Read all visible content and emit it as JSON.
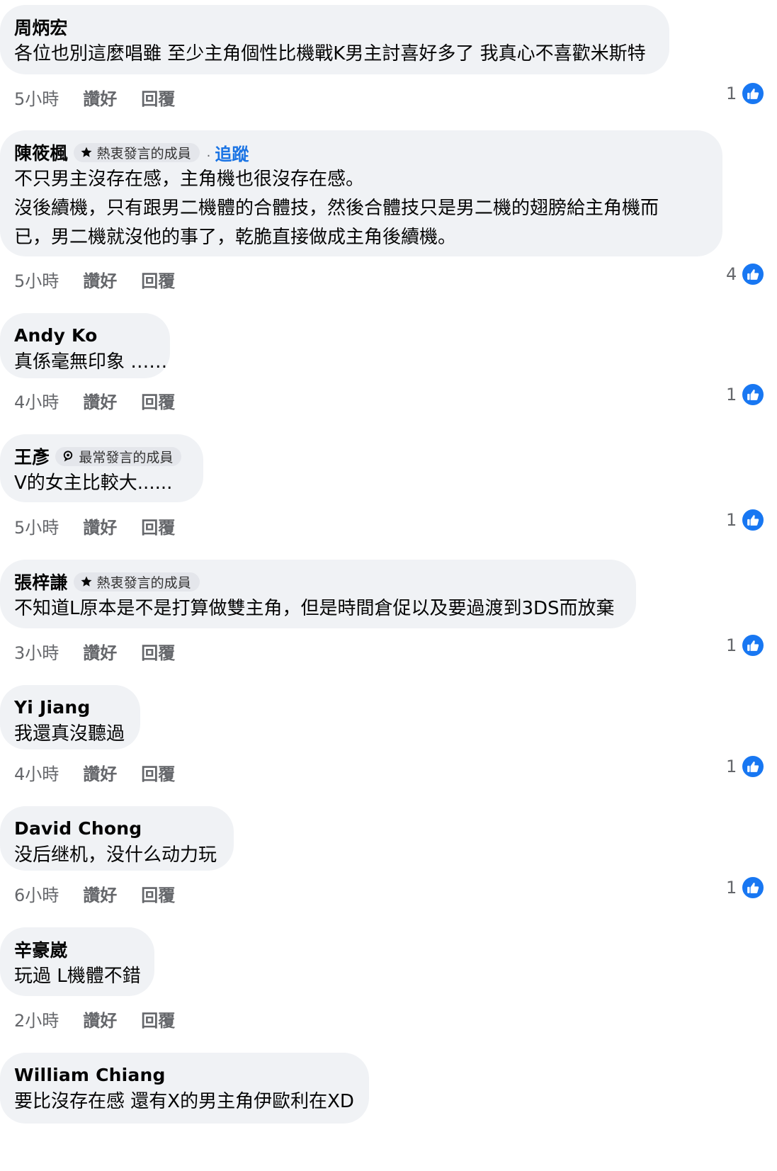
{
  "actions": {
    "like": "讚好",
    "reply": "回覆"
  },
  "comments": [
    {
      "name": "周炳宏",
      "text": [
        "各位也別這麼唱雖 至少主角個性比機戰K男主討喜好多了 我真心不喜歡米斯特"
      ],
      "time": "5小時",
      "reactions": "1"
    },
    {
      "name": "陳筱楓",
      "badge": "熱衷發言的成員",
      "follow": "追蹤",
      "text": [
        "不只男主沒存在感，主角機也很沒存在感。",
        "沒後續機，只有跟男二機體的合體技，然後合體技只是男二機的翅膀給主角機而",
        "已，男二機就沒他的事了，乾脆直接做成主角後續機。"
      ],
      "time": "5小時",
      "reactions": "4"
    },
    {
      "name": "Andy Ko",
      "text": [
        "真係毫無印象 ……"
      ],
      "time": "4小時",
      "reactions": "1"
    },
    {
      "name": "王彥",
      "badge": "最常發言的成員",
      "text": [
        "V的女主比較大......"
      ],
      "time": "5小時",
      "reactions": "1"
    },
    {
      "name": "張梓謙",
      "badge": "熱衷發言的成員",
      "text": [
        "不知道L原本是不是打算做雙主角，但是時間倉促以及要過渡到3DS而放棄"
      ],
      "time": "3小時",
      "reactions": "1"
    },
    {
      "name": "Yi Jiang",
      "text": [
        "我還真沒聽過"
      ],
      "time": "4小時",
      "reactions": "1"
    },
    {
      "name": "David Chong",
      "text": [
        "没后继机，没什么动力玩"
      ],
      "time": "6小時",
      "reactions": "1"
    },
    {
      "name": "辛豪崴",
      "text": [
        "玩過 L機體不錯"
      ],
      "time": "2小時",
      "reactions": ""
    },
    {
      "name": "William  Chiang",
      "text": [
        "要比沒存在感 還有X的男主角伊歐利在XD"
      ],
      "time": "",
      "reactions": ""
    }
  ]
}
